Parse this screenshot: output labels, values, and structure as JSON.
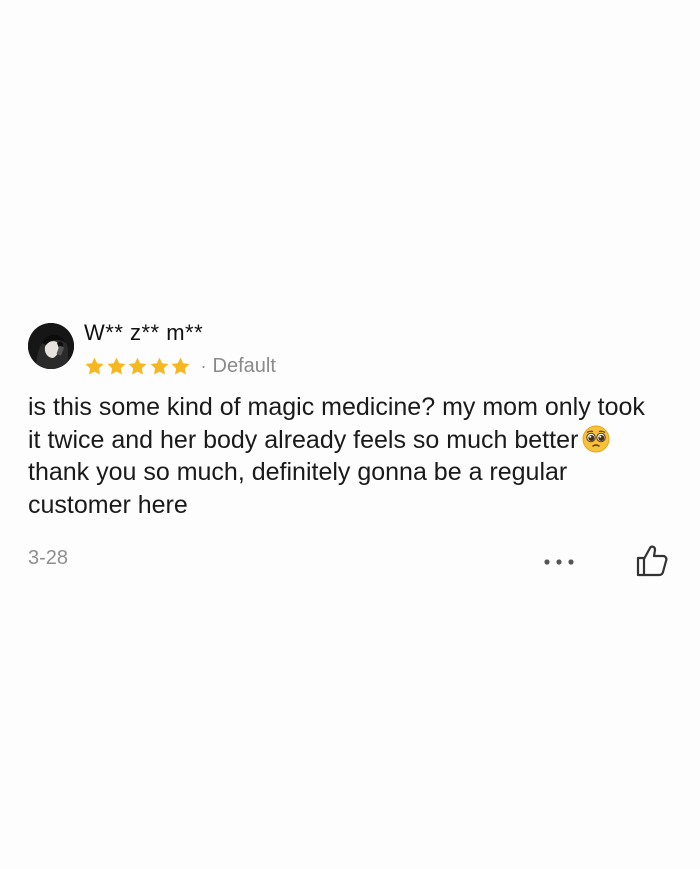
{
  "review": {
    "username": "W** z** m**",
    "rating": 5,
    "rating_max": 5,
    "separator": "·",
    "variant": "Default",
    "body_part1": "is this some kind of magic medicine? my mom only took it twice and her body already feels so much better",
    "emoji": "pleading-face-icon",
    "body_part2": "thank you so much, definitely gonna be a regular customer here",
    "date": "3-28"
  },
  "colors": {
    "star": "#f5b820",
    "secondary_text": "#8a8a8a",
    "primary_text": "#1a1a1a",
    "background": "#fdfdfd"
  },
  "icons": {
    "more": "more-dots-icon",
    "like": "thumbs-up-icon",
    "avatar": "avatar-image"
  }
}
